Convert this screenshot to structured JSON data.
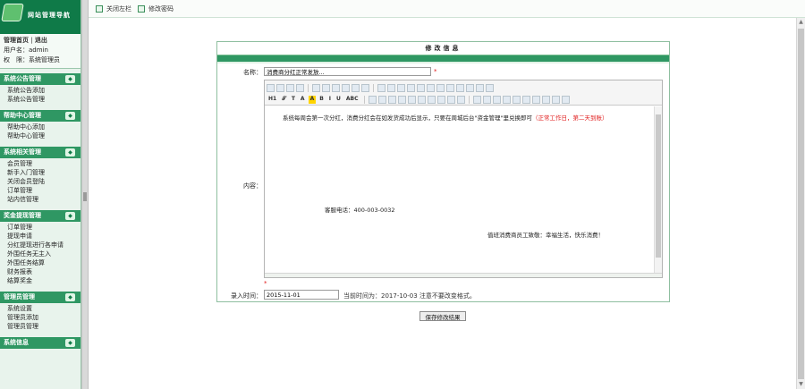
{
  "colors": {
    "brand": "#0f7a48",
    "section_header": "#2f9763",
    "required": "#e01b1b"
  },
  "sidebar": {
    "title": "网站管理导航",
    "nav_links": [
      "管理首页",
      "退出"
    ],
    "user_label": "用户名：",
    "user_name": "admin",
    "role_label": "权　限：",
    "role_value": "系统管理员",
    "sections": [
      {
        "title": "系统公告管理",
        "icon": "notice-icon",
        "items": [
          "系统公告添加",
          "系统公告管理"
        ]
      },
      {
        "title": "帮助中心管理",
        "icon": "help-icon",
        "items": [
          "帮助中心添加",
          "帮助中心管理"
        ]
      },
      {
        "title": "系统相关管理",
        "icon": "settings-icon",
        "items": [
          "会员管理",
          "新手入门管理",
          "关闭会员登陆",
          "订单管理",
          "站内信管理"
        ]
      },
      {
        "title": "奖金提现管理",
        "icon": "money-icon",
        "items": [
          "订单管理",
          "提现申请",
          "分红提现进行各申请",
          "外围任务无主入",
          "外围任务结算",
          "财务报表",
          "结算奖金"
        ]
      },
      {
        "title": "管理员管理",
        "icon": "admin-icon",
        "items": [
          "系统设置",
          "管理员添加",
          "管理员管理"
        ]
      },
      {
        "title": "系统信息",
        "icon": "info-icon",
        "items": []
      }
    ]
  },
  "topbar": {
    "close_left": "关闭左栏",
    "change_password": "修改密码"
  },
  "form": {
    "title": "修改信息",
    "name_label": "名称：",
    "name_value": "消费商分红正常发放...",
    "required_mark": "*",
    "content_label": "内容：",
    "toolbar_row1": [
      "源",
      "HTML",
      "撤销",
      "重做",
      "剪切",
      "复制",
      "粘贴",
      "粘贴文本",
      "粘贴Word",
      "查找",
      "左对齐",
      "居中",
      "右对齐",
      "两端",
      "编号",
      "项目",
      "缩进",
      "减缩进",
      "上标",
      "下标",
      "清格式",
      "全选"
    ],
    "toolbar_row2_text": [
      "H1",
      "𝒯",
      "T",
      "A",
      "A",
      "B",
      "I",
      "U",
      "ABC"
    ],
    "content": {
      "para1": "系统每周会第一次分红，消费分红会在如发货成功后显示，只要在周城后台\"资金管理\"里兑换即可",
      "para1_red": "（正常工作日，第二天到账）",
      "phone_label": "客服电话：",
      "phone": "400-003-0032",
      "closing": "值班消费商员工致敬：幸福生活，快乐消费！"
    },
    "date_label": "录入时间：",
    "date_value": "2015-11-01",
    "date_note": "当前时间为：2017-10-03 注意不要改变格式。",
    "save_button": "保存修改结果"
  }
}
